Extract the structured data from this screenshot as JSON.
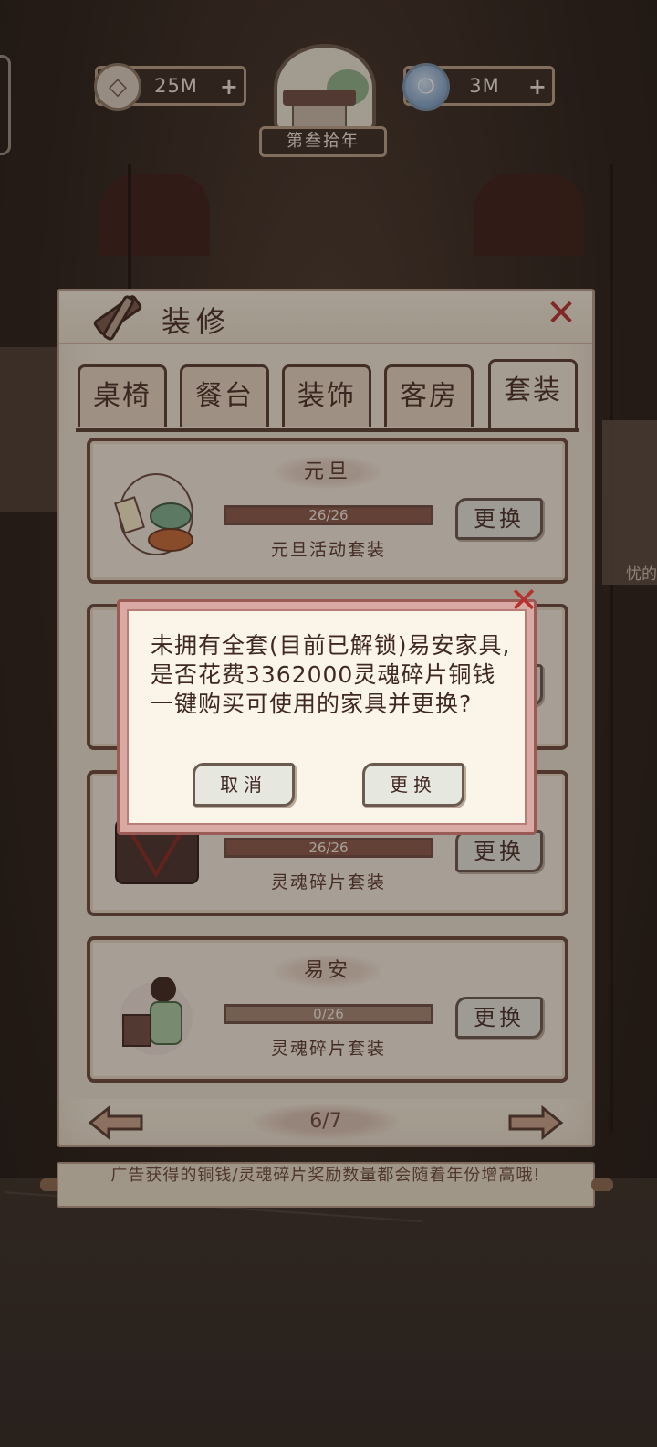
{
  "resources": {
    "coin": {
      "value": "25M",
      "icon": "coin-icon",
      "plus": "+"
    },
    "soul": {
      "value": "3M",
      "icon": "soul-flame-icon",
      "plus": "+"
    }
  },
  "year": {
    "label": "第叁拾年"
  },
  "panel": {
    "title": "装修",
    "close": "✕",
    "tabs": [
      {
        "label": "桌椅",
        "active": false
      },
      {
        "label": "餐台",
        "active": false
      },
      {
        "label": "装饰",
        "active": false
      },
      {
        "label": "客房",
        "active": false
      },
      {
        "label": "套装",
        "active": true
      }
    ],
    "cards": [
      {
        "name": "元旦",
        "progress": "26/26",
        "progress_fraction": 1.0,
        "desc": "元旦活动套装",
        "button": "更换"
      },
      {
        "name": "",
        "progress": "",
        "progress_fraction": 1.0,
        "desc": "",
        "button": ""
      },
      {
        "name": "",
        "progress": "26/26",
        "progress_fraction": 1.0,
        "desc": "灵魂碎片套装",
        "button": "更换"
      },
      {
        "name": "易安",
        "progress": "0/26",
        "progress_fraction": 0.0,
        "desc": "灵魂碎片套装",
        "button": "更换"
      }
    ],
    "pager": {
      "page": "6/7"
    }
  },
  "tip": {
    "text": "广告获得的铜钱/灵魂碎片奖励数量都会随着年份增高哦!"
  },
  "background": {
    "side_text": "忧的"
  },
  "dialog": {
    "message": "未拥有全套(目前已解锁)易安家具,是否花费3362000灵魂碎片铜钱一键购买可使用的家具并更换?",
    "cancel": "取消",
    "confirm": "更换",
    "close": "✕"
  },
  "colors": {
    "accent_red": "#b7322f",
    "panel_bg": "#efe6d7",
    "border_brown": "#6a4a3e"
  }
}
